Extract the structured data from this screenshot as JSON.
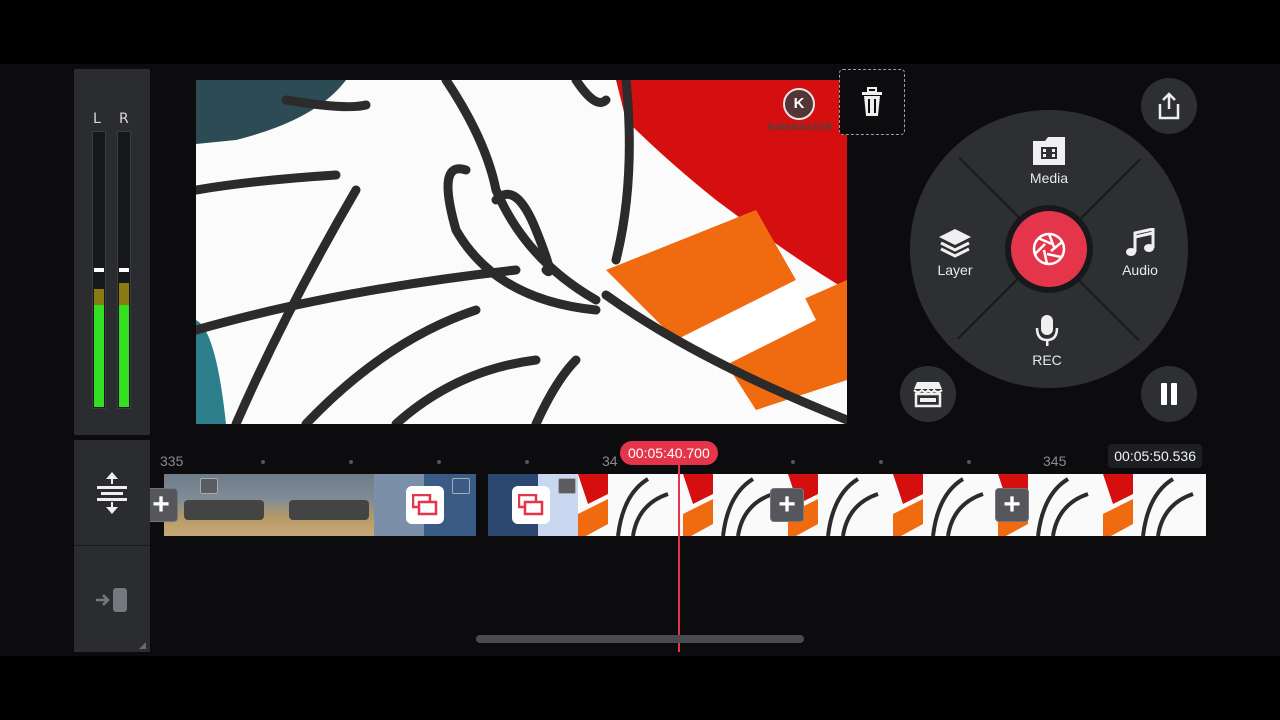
{
  "meter": {
    "left_label": "L",
    "right_label": "R",
    "left_level": 0.42,
    "right_level": 0.42
  },
  "watermark": {
    "logo_letter": "K",
    "text": "KINEMASTER"
  },
  "wheel": {
    "media_label": "Media",
    "layer_label": "Layer",
    "audio_label": "Audio",
    "rec_label": "REC"
  },
  "timeline": {
    "ruler_labels": [
      "335",
      "34",
      "345"
    ],
    "current_time": "00:05:40.700",
    "total_time": "00:05:50.536"
  },
  "colors": {
    "accent": "#e5354a",
    "panel": "#2b2c30",
    "meter_green": "#33e021"
  },
  "icons": [
    "trash-icon",
    "share-icon",
    "media-icon",
    "layer-icon",
    "audio-icon",
    "mic-icon",
    "camera-shutter-icon",
    "asset-store-icon",
    "pause-icon",
    "timeline-expand-icon",
    "timeline-exit-icon"
  ]
}
